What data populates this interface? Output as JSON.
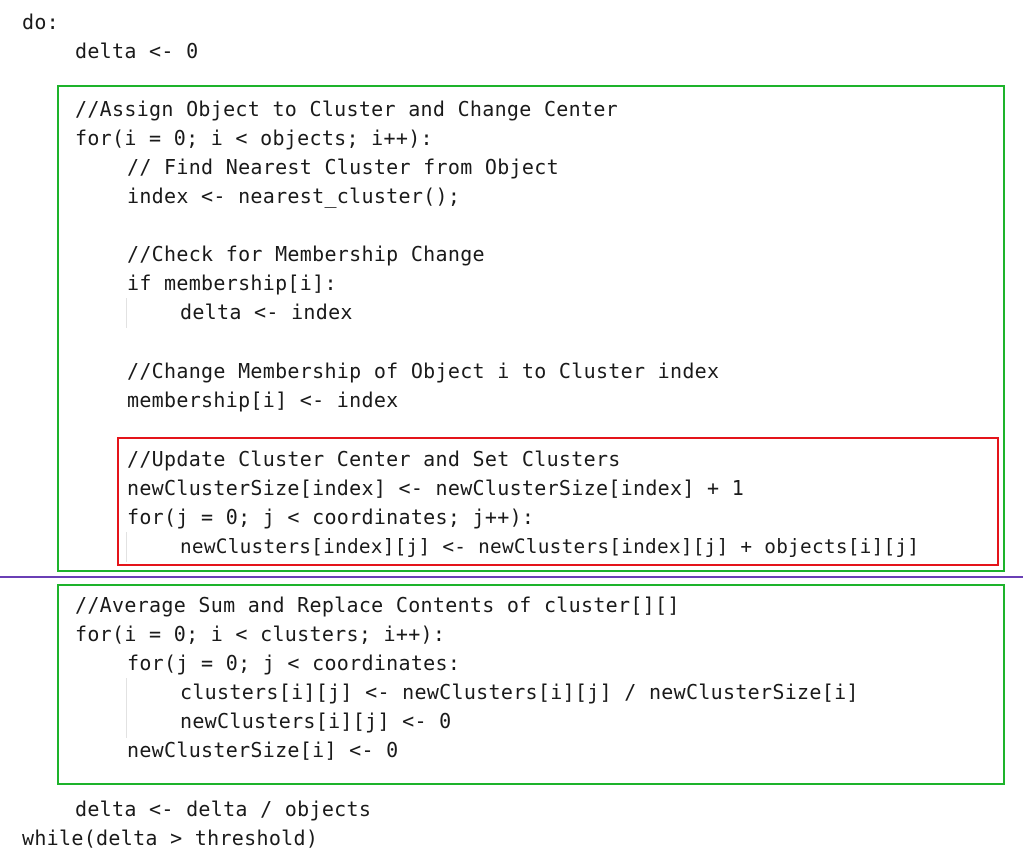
{
  "code": {
    "lines": [
      "do:",
      "delta <- 0",
      "//Assign Object to Cluster and Change Center",
      "for(i = 0; i < objects; i++):",
      "// Find Nearest Cluster from Object",
      "index <- nearest_cluster();",
      "//Check for Membership Change",
      "if membership[i]:",
      "delta <- index",
      "//Change Membership of Object i to Cluster index",
      "membership[i] <- index",
      "//Update Cluster Center and Set Clusters",
      "newClusterSize[index] <- newClusterSize[index] + 1",
      "for(j = 0; j < coordinates; j++):",
      "newClusters[index][j] <- newClusters[index][j] + objects[i][j]",
      "//Average Sum and Replace Contents of cluster[][]",
      "for(i = 0; i < clusters; i++):",
      "for(j = 0; j < coordinates:",
      "clusters[i][j] <- newClusters[i][j] / newClusterSize[i]",
      "newClusters[i][j] <- 0",
      "newClusterSize[i] <- 0",
      "delta <- delta / objects",
      "while(delta > threshold)"
    ]
  },
  "colors": {
    "green_box": "#1db32b",
    "red_box": "#e4141a",
    "divider": "#6a3fb5"
  }
}
